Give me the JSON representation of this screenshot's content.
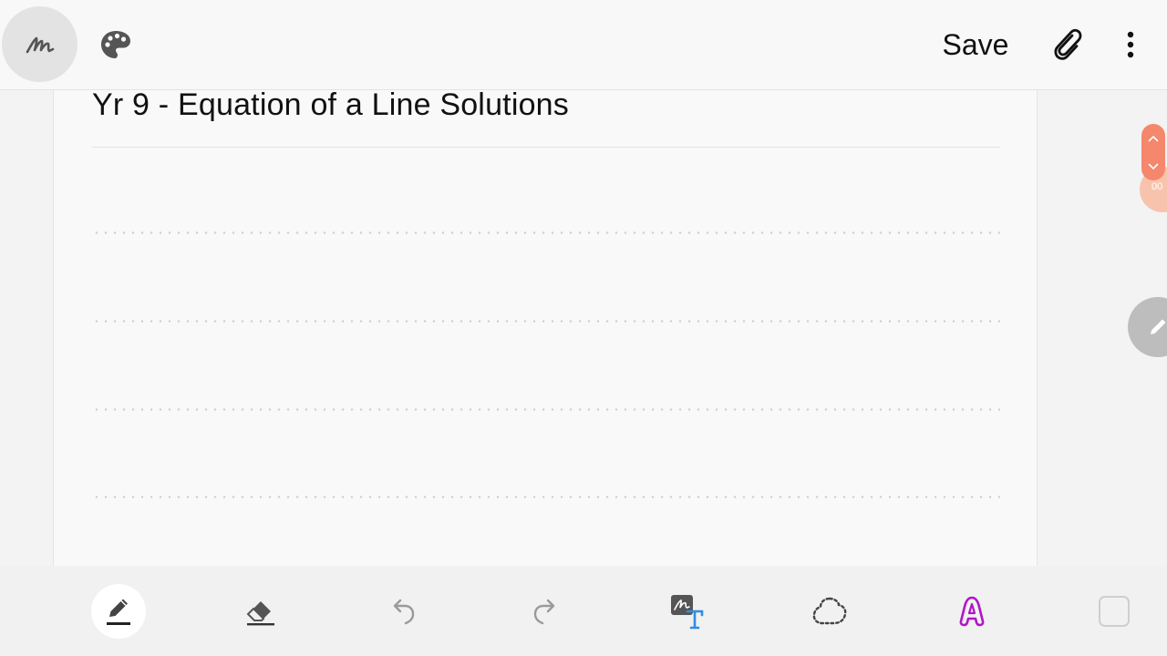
{
  "header": {
    "save_label": "Save"
  },
  "note": {
    "title": "Yr 9 - Equation of a Line Solutions"
  },
  "scroll_widget": {
    "count": "00"
  },
  "icons": {
    "pen_mode": "handwriting-icon",
    "palette": "palette-icon",
    "attach": "paperclip-icon",
    "more": "more-vertical-icon",
    "pen": "pen-icon",
    "eraser": "eraser-icon",
    "undo": "undo-icon",
    "redo": "redo-icon",
    "handwriting_to_text": "handwriting-to-text-icon",
    "lasso": "lasso-selection-icon",
    "text_style": "text-style-icon",
    "shape": "shape-icon",
    "floating_pen": "pen-icon"
  },
  "colors": {
    "accent_blue": "#2f8de4",
    "text_style_purple": "#b016c8",
    "scroll_orange": "#f5876c",
    "active_tool_bg": "#ffffff"
  }
}
